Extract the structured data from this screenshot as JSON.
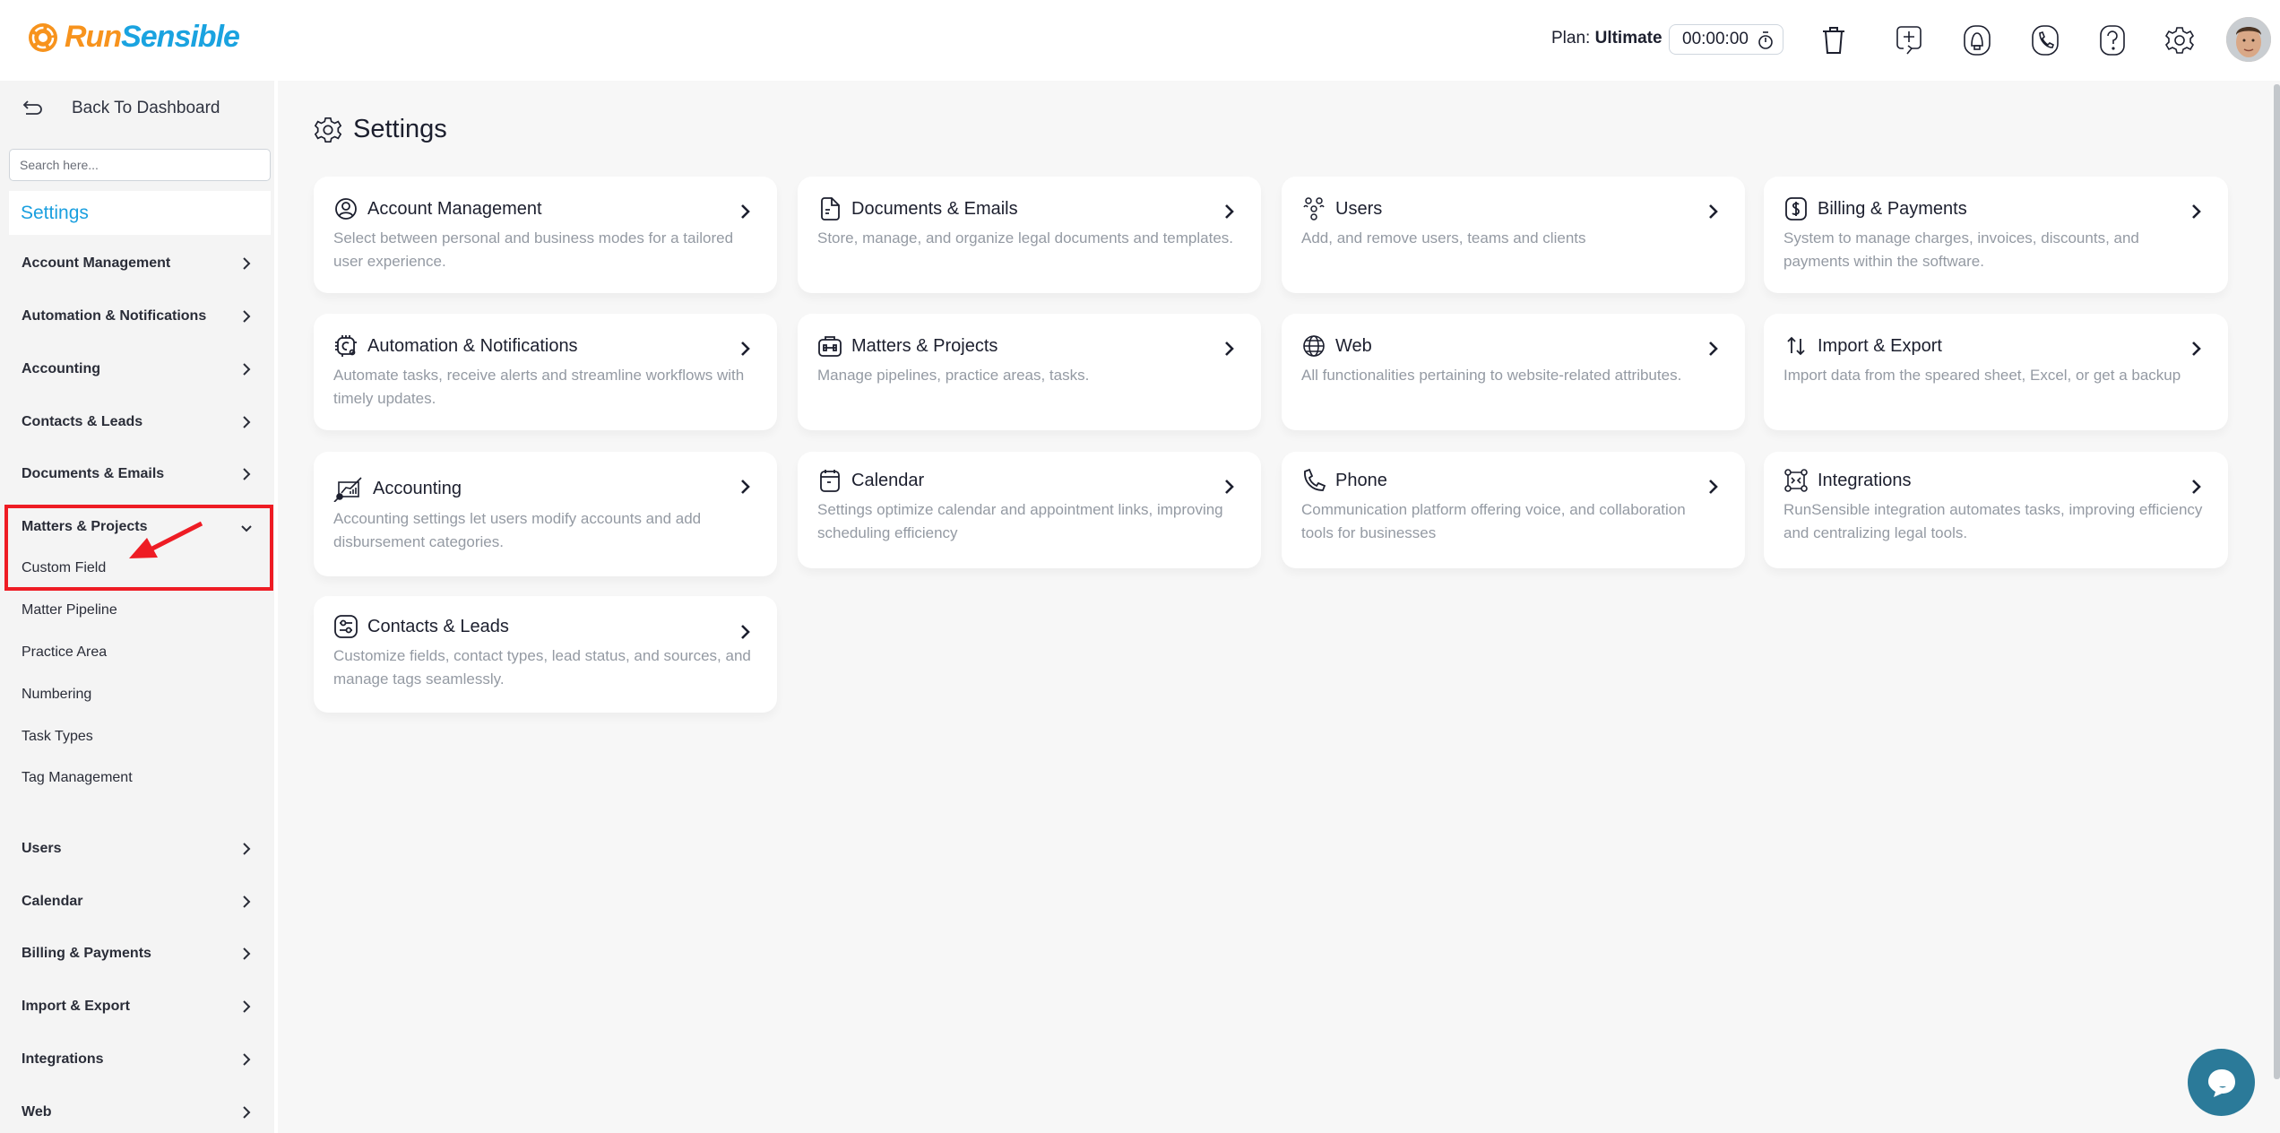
{
  "header": {
    "logo_part1": "Run",
    "logo_part2": "Sensible",
    "plan_label": "Plan:",
    "plan_value": "Ultimate",
    "timer": "00:00:00",
    "icons": [
      "trash-icon",
      "add-task-icon",
      "bell-icon",
      "phone-icon",
      "help-icon",
      "gear-icon"
    ]
  },
  "sidebar": {
    "back_label": "Back To Dashboard",
    "search_placeholder": "Search here...",
    "section_title": "Settings",
    "items": [
      {
        "label": "Account Management"
      },
      {
        "label": "Automation & Notifications"
      },
      {
        "label": "Accounting"
      },
      {
        "label": "Contacts & Leads"
      },
      {
        "label": "Documents & Emails"
      },
      {
        "label": "Matters & Projects",
        "expanded": true
      },
      {
        "label": "Users"
      },
      {
        "label": "Calendar"
      },
      {
        "label": "Billing & Payments"
      },
      {
        "label": "Import & Export"
      },
      {
        "label": "Integrations"
      },
      {
        "label": "Web"
      }
    ],
    "subitems": [
      {
        "label": "Custom Field",
        "highlighted": true
      },
      {
        "label": "Matter Pipeline"
      },
      {
        "label": "Practice Area"
      },
      {
        "label": "Numbering"
      },
      {
        "label": "Task Types"
      },
      {
        "label": "Tag Management"
      }
    ]
  },
  "main": {
    "title": "Settings",
    "cards": [
      {
        "title": "Account Management",
        "icon": "user-circle-icon",
        "desc": "Select between personal and business modes for a tailored user experience."
      },
      {
        "title": "Documents & Emails",
        "icon": "document-icon",
        "desc": "Store, manage, and organize legal documents and templates."
      },
      {
        "title": "Users",
        "icon": "users-group-icon",
        "desc": "Add, and remove users, teams and clients"
      },
      {
        "title": "Billing & Payments",
        "icon": "dollar-icon",
        "desc": "System to manage charges, invoices, discounts, and payments within the software."
      },
      {
        "title": "Automation & Notifications",
        "icon": "automation-gear-icon",
        "desc": "Automate tasks, receive alerts and streamline workflows with timely updates."
      },
      {
        "title": "Matters & Projects",
        "icon": "briefcase-icon",
        "desc": "Manage pipelines, practice areas, tasks."
      },
      {
        "title": "Web",
        "icon": "globe-icon",
        "desc": "All functionalities pertaining to website-related attributes."
      },
      {
        "title": "Import & Export",
        "icon": "import-export-icon",
        "desc": "Import data from the speared sheet, Excel, or get a backup"
      },
      {
        "title": "Accounting",
        "icon": "accounting-chart-icon",
        "desc": "Accounting settings let users modify accounts and add disbursement categories."
      },
      {
        "title": "Calendar",
        "icon": "calendar-icon",
        "desc": "Settings optimize calendar and appointment links, improving scheduling efficiency"
      },
      {
        "title": "Phone",
        "icon": "phone-icon",
        "desc": "Communication platform offering voice, and collaboration tools for businesses"
      },
      {
        "title": "Integrations",
        "icon": "integrations-icon",
        "desc": "RunSensible integration automates tasks, improving efficiency and centralizing legal tools."
      },
      {
        "title": "Contacts & Leads",
        "icon": "contacts-settings-icon",
        "desc": "Customize fields, contact types, lead status, and sources, and manage tags seamlessly."
      }
    ]
  },
  "colors": {
    "accent": "#1aa3e0",
    "logo_orange": "#f7931d",
    "highlight_red": "#ee1c24",
    "chat_button": "#2b7a99"
  }
}
